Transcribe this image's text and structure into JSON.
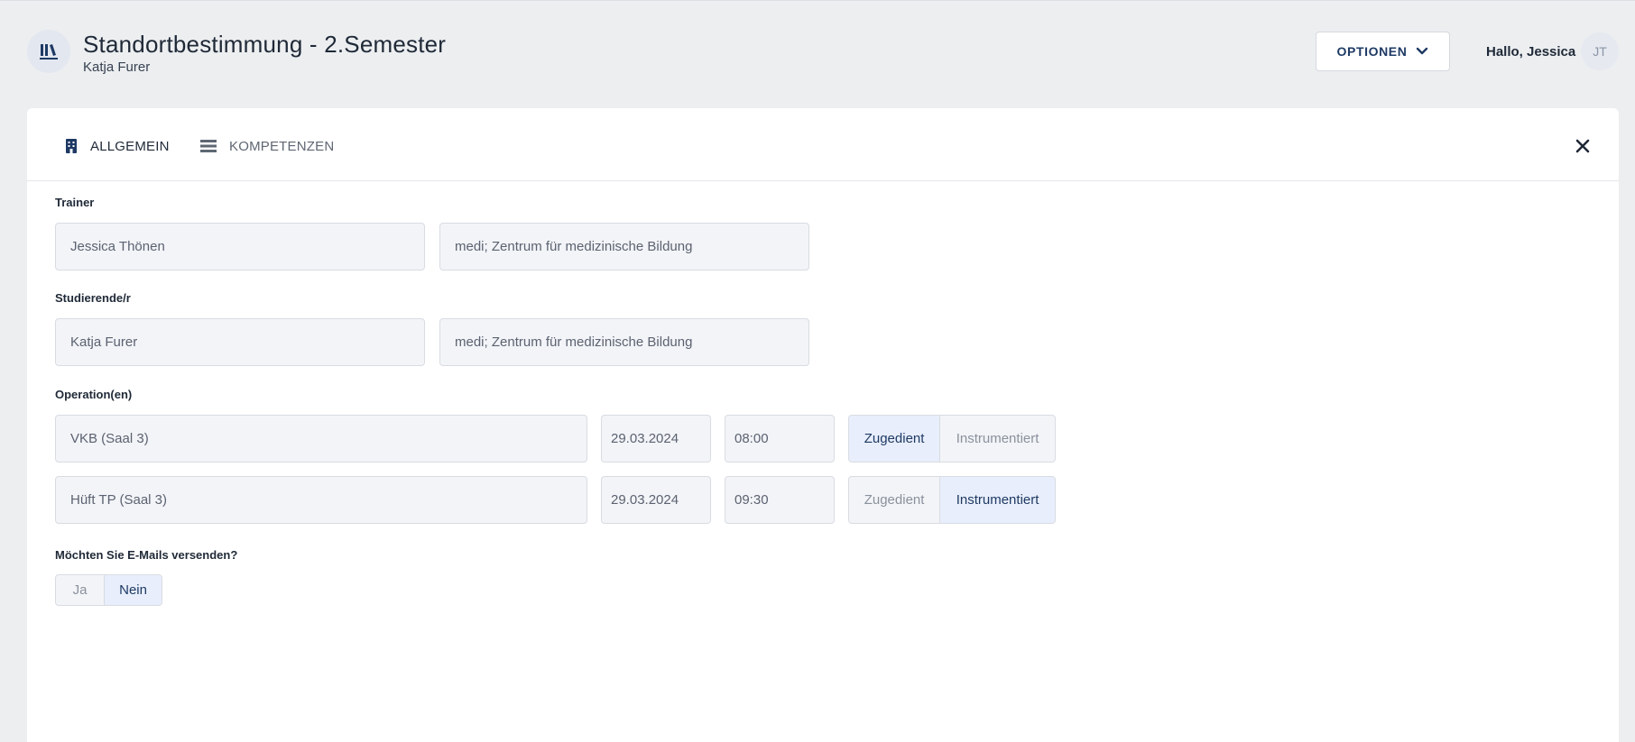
{
  "header": {
    "title": "Standortbestimmung - 2.Semester",
    "subtitle": "Katja Furer",
    "options_label": "OPTIONEN",
    "greeting": "Hallo, Jessica",
    "avatar_initials": "JT"
  },
  "tabs": [
    {
      "label": "ALLGEMEIN",
      "icon": "building-icon",
      "active": true
    },
    {
      "label": "KOMPETENZEN",
      "icon": "list-icon",
      "active": false
    }
  ],
  "form": {
    "trainer": {
      "label": "Trainer",
      "name": "Jessica Thönen",
      "institution": "medi; Zentrum für medizinische Bildung"
    },
    "student": {
      "label": "Studierende/r",
      "name": "Katja Furer",
      "institution": "medi; Zentrum für medizinische Bildung"
    },
    "operations": {
      "label": "Operation(en)",
      "rows": [
        {
          "name": "VKB (Saal 3)",
          "date": "29.03.2024",
          "time": "08:00",
          "option_a": "Zugedient",
          "option_b": "Instrumentiert",
          "selected": "Zugedient"
        },
        {
          "name": "Hüft TP (Saal 3)",
          "date": "29.03.2024",
          "time": "09:30",
          "option_a": "Zugedient",
          "option_b": "Instrumentiert",
          "selected": "Instrumentiert"
        }
      ]
    },
    "emails": {
      "label": "Möchten Sie E-Mails versenden?",
      "yes": "Ja",
      "no": "Nein",
      "selected": "Nein"
    }
  },
  "colors": {
    "accent": "#1e3a64",
    "background": "#eceef0",
    "active_segment": "#e8eefb"
  }
}
